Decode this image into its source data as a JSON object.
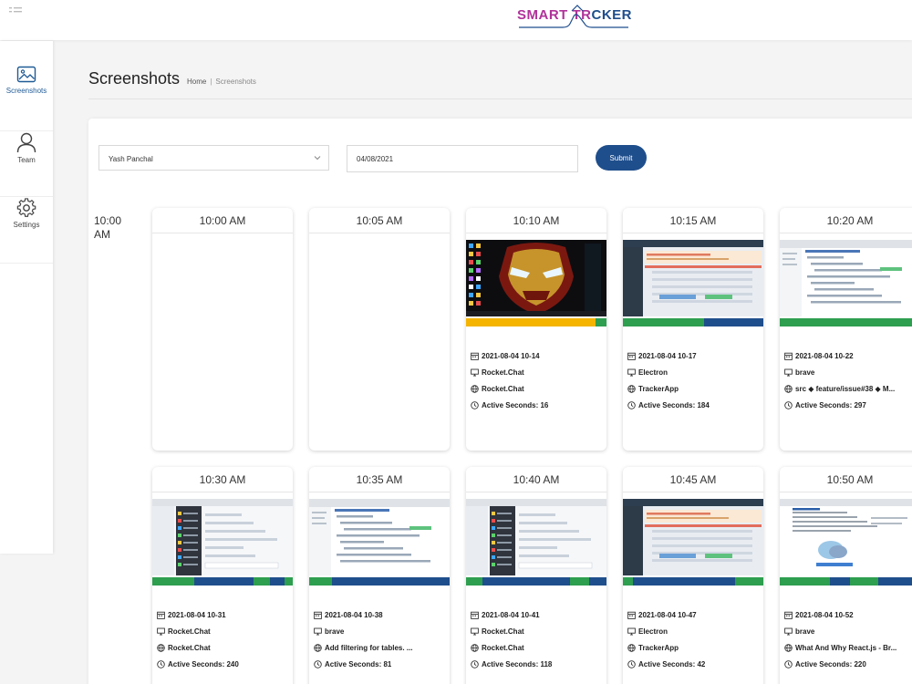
{
  "app": {
    "logo_part1": "SMART TR",
    "logo_part2": "CKER"
  },
  "sidebar": {
    "items": [
      {
        "label": "Screenshots",
        "icon": "image-icon",
        "active": true
      },
      {
        "label": "Team",
        "icon": "user-icon",
        "active": false
      },
      {
        "label": "Settings",
        "icon": "gear-icon",
        "active": false
      }
    ]
  },
  "header": {
    "title": "Screenshots",
    "breadcrumb_home": "Home",
    "breadcrumb_separator": "|",
    "breadcrumb_current": "Screenshots"
  },
  "filters": {
    "user_selected": "Yash Panchal",
    "date_value": "04/08/2021",
    "submit_label": "Submit"
  },
  "hour_label": "10:00 AM",
  "cards": [
    {
      "time": "10:00 AM",
      "empty": true
    },
    {
      "time": "10:05 AM",
      "empty": true
    },
    {
      "time": "10:10 AM",
      "empty": false,
      "thumb": "desktop",
      "bar": [
        [
          "#f4b400",
          0.92
        ],
        [
          "#2e9e4f",
          0.08
        ]
      ],
      "date": "2021-08-04 10-14",
      "app": "Rocket.Chat",
      "window": "Rocket.Chat",
      "active": "Active Seconds: 16"
    },
    {
      "time": "10:15 AM",
      "empty": false,
      "thumb": "app",
      "bar": [
        [
          "#2e9e4f",
          0.58
        ],
        [
          "#1f4e8c",
          0.42
        ]
      ],
      "date": "2021-08-04 10-17",
      "app": "Electron",
      "window": "TrackerApp",
      "active": "Active Seconds: 184"
    },
    {
      "time": "10:20 AM",
      "empty": false,
      "thumb": "code",
      "bar": [
        [
          "#2e9e4f",
          1.0
        ]
      ],
      "date": "2021-08-04 10-22",
      "app": "brave",
      "window": "src ◆ feature/issue#38 ◆ M...",
      "active": "Active Seconds: 297"
    },
    {
      "time": "10:30 AM",
      "empty": false,
      "thumb": "chat",
      "bar": [
        [
          "#2e9e4f",
          0.3
        ],
        [
          "#1f4e8c",
          0.42
        ],
        [
          "#2e9e4f",
          0.12
        ],
        [
          "#1f4e8c",
          0.1
        ],
        [
          "#2e9e4f",
          0.06
        ]
      ],
      "date": "2021-08-04 10-31",
      "app": "Rocket.Chat",
      "window": "Rocket.Chat",
      "active": "Active Seconds: 240"
    },
    {
      "time": "10:35 AM",
      "empty": false,
      "thumb": "code",
      "bar": [
        [
          "#2e9e4f",
          0.16
        ],
        [
          "#1f4e8c",
          0.84
        ]
      ],
      "date": "2021-08-04 10-38",
      "app": "brave",
      "window": "Add filtering for tables. ...",
      "active": "Active Seconds: 81"
    },
    {
      "time": "10:40 AM",
      "empty": false,
      "thumb": "chat",
      "bar": [
        [
          "#2e9e4f",
          0.12
        ],
        [
          "#1f4e8c",
          0.62
        ],
        [
          "#2e9e4f",
          0.14
        ],
        [
          "#1f4e8c",
          0.12
        ]
      ],
      "date": "2021-08-04 10-41",
      "app": "Rocket.Chat",
      "window": "Rocket.Chat",
      "active": "Active Seconds: 118"
    },
    {
      "time": "10:45 AM",
      "empty": false,
      "thumb": "app",
      "bar": [
        [
          "#2e9e4f",
          0.07
        ],
        [
          "#1f4e8c",
          0.73
        ],
        [
          "#2e9e4f",
          0.2
        ]
      ],
      "date": "2021-08-04 10-47",
      "app": "Electron",
      "window": "TrackerApp",
      "active": "Active Seconds: 42"
    },
    {
      "time": "10:50 AM",
      "empty": false,
      "thumb": "article",
      "bar": [
        [
          "#2e9e4f",
          0.36
        ],
        [
          "#1f4e8c",
          0.14
        ],
        [
          "#2e9e4f",
          0.2
        ],
        [
          "#1f4e8c",
          0.3
        ]
      ],
      "date": "2021-08-04 10-52",
      "app": "brave",
      "window": "What And Why React.js - Br...",
      "active": "Active Seconds: 220"
    }
  ]
}
